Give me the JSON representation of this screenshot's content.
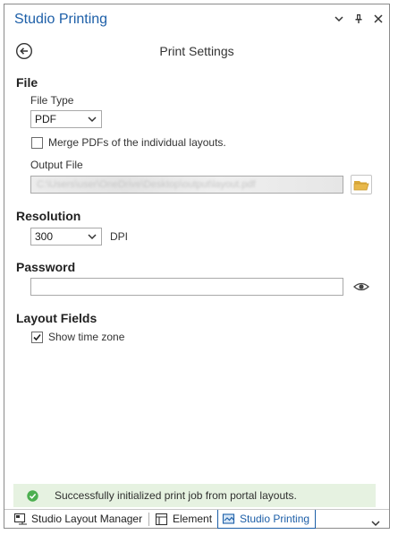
{
  "panel": {
    "title": "Studio Printing",
    "page_title": "Print Settings"
  },
  "file": {
    "heading": "File",
    "file_type_label": "File Type",
    "file_type_value": "PDF",
    "merge_label": "Merge PDFs of the individual layouts.",
    "merge_checked": false,
    "output_label": "Output File"
  },
  "resolution": {
    "heading": "Resolution",
    "value": "300",
    "unit": "DPI"
  },
  "password": {
    "heading": "Password",
    "value": ""
  },
  "layout_fields": {
    "heading": "Layout Fields",
    "show_time_zone_label": "Show time zone",
    "show_time_zone_checked": true
  },
  "status": {
    "message": "Successfully initialized print job from portal layouts."
  },
  "tabs": [
    {
      "label": "Studio Layout Manager",
      "icon": "layout-manager-icon",
      "active": false
    },
    {
      "label": "Element",
      "icon": "element-icon",
      "active": false
    },
    {
      "label": "Studio Printing",
      "icon": "printing-icon",
      "active": true
    }
  ],
  "colors": {
    "accent": "#1d5fa8",
    "status_bg": "#e6f2e1",
    "success": "#4caf50",
    "folder": "#e8b84a"
  }
}
